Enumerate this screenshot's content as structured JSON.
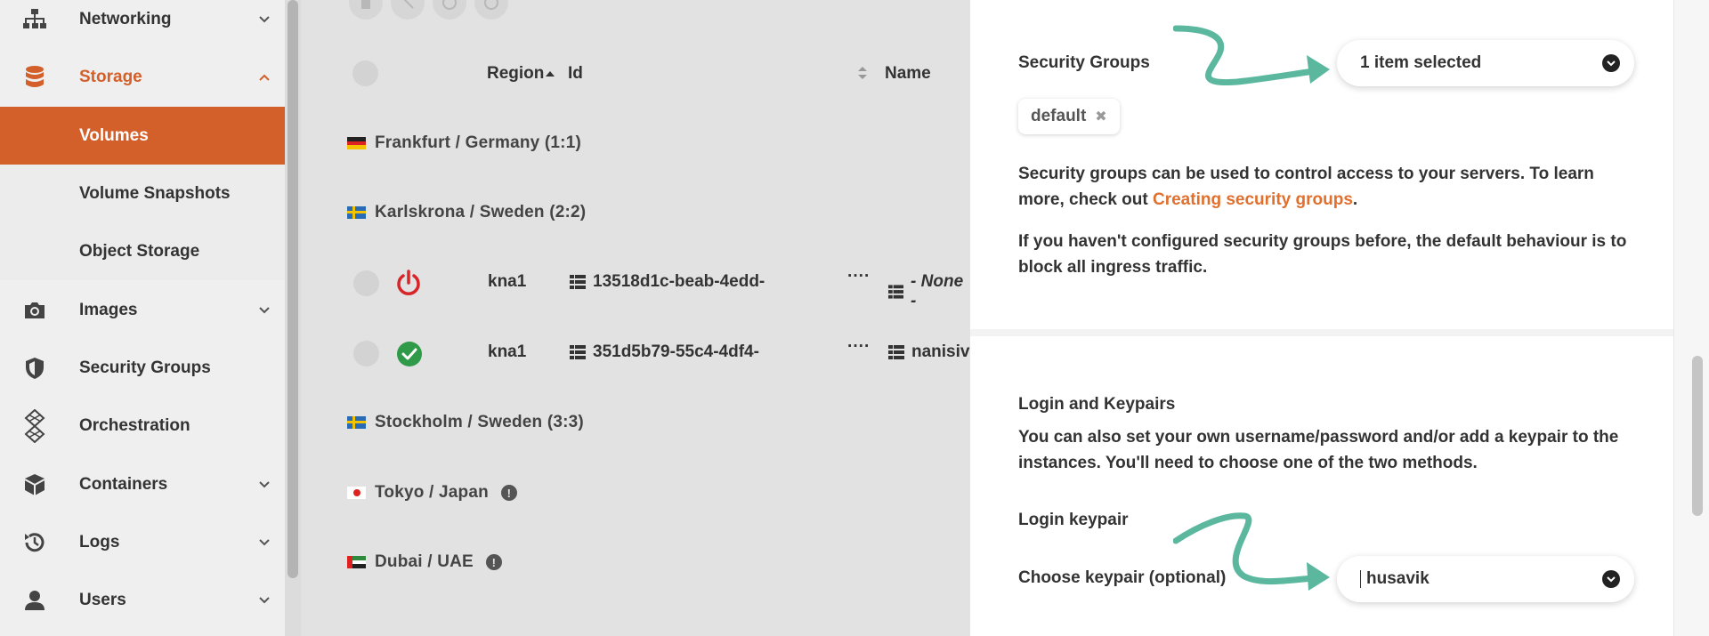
{
  "sidebar": {
    "items": [
      {
        "label": "Networking",
        "icon": "network-icon"
      },
      {
        "label": "Storage",
        "icon": "database-icon"
      },
      {
        "label": "Images",
        "icon": "camera-icon"
      },
      {
        "label": "Security Groups",
        "icon": "shield-icon"
      },
      {
        "label": "Orchestration",
        "icon": "orchestration-icon"
      },
      {
        "label": "Containers",
        "icon": "cube-icon"
      },
      {
        "label": "Logs",
        "icon": "history-icon"
      },
      {
        "label": "Users",
        "icon": "user-icon"
      }
    ],
    "storage_sub": [
      {
        "label": "Volumes"
      },
      {
        "label": "Volume Snapshots"
      },
      {
        "label": "Object Storage"
      }
    ],
    "accent": "#d3602a"
  },
  "table": {
    "headers": {
      "region": "Region",
      "id": "Id",
      "name": "Name"
    },
    "groups": [
      {
        "label": "Frankfurt / Germany",
        "count": "(1:1)"
      },
      {
        "label": "Karlskrona / Sweden",
        "count": "(2:2)"
      },
      {
        "label": "Stockholm / Sweden",
        "count": "(3:3)"
      },
      {
        "label": "Tokyo / Japan",
        "count": ""
      },
      {
        "label": "Dubai / UAE",
        "count": ""
      }
    ],
    "rows": [
      {
        "region": "kna1",
        "id": "13518d1c-beab-4edd-",
        "more": "····",
        "name": "- None -",
        "status": "power-off"
      },
      {
        "region": "kna1",
        "id": "351d5b79-55c4-4df4-",
        "more": "····",
        "name": "nanisivi",
        "status": "ok"
      }
    ]
  },
  "panel": {
    "security_groups_label": "Security Groups",
    "security_groups_value": "1 item selected",
    "tag_default": "default",
    "sg_desc_1": "Security groups can be used to control access to your servers. To learn more, check out ",
    "sg_link": "Creating security groups",
    "sg_desc_end": ".",
    "sg_desc_2": "If you haven't configured security groups before, the default behaviour is to block all ingress traffic.",
    "login_title": "Login and Keypairs",
    "login_desc": "You can also set your own username/password and/or add a keypair to the instances. You'll need to choose one of the two methods.",
    "login_keypair_label": "Login keypair",
    "choose_keypair_label": "Choose keypair (optional)",
    "keypair_value": "husavik",
    "arrow_color": "#5bb89f",
    "link_color": "#e0702e"
  }
}
